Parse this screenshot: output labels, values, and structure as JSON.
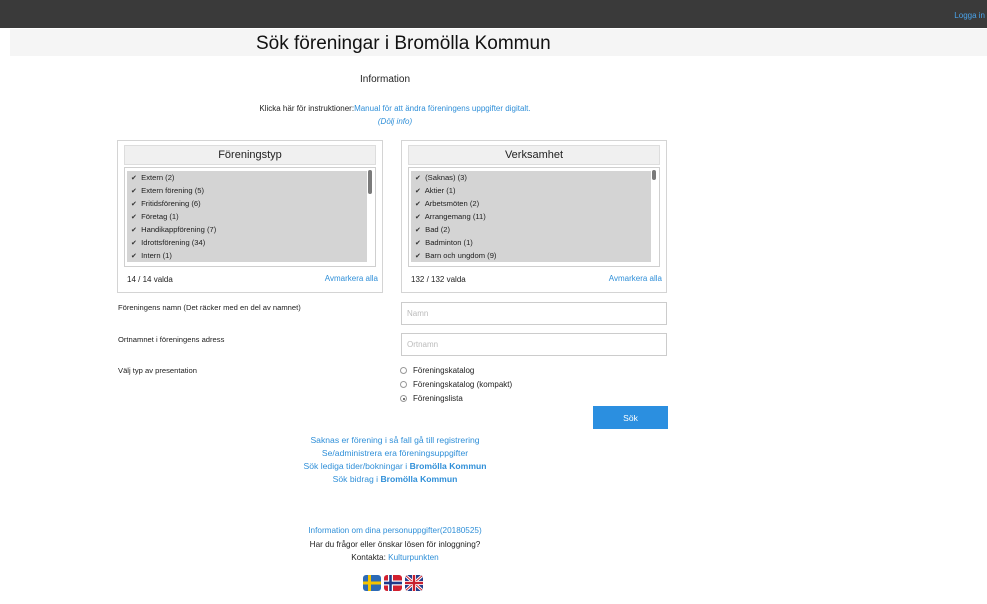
{
  "topbar": {
    "login_label": "Logga in"
  },
  "header": {
    "title": "Sök föreningar i Bromölla Kommun"
  },
  "info": {
    "title": "Information",
    "instructions_prefix": "Klicka här för instruktioner:",
    "manual_link": "Manual för att ändra föreningens uppgifter digitalt.",
    "hide_link": "(Dölj info)"
  },
  "foreningstyp": {
    "title": "Föreningstyp",
    "items": [
      "Extern (2)",
      "Extern förening (5)",
      "Fritidsförening (6)",
      "Företag (1)",
      "Handikappförening (7)",
      "Idrottsförening (34)",
      "Intern (1)"
    ],
    "count": "14 / 14 valda",
    "unmark_label": "Avmarkera alla"
  },
  "verksamhet": {
    "title": "Verksamhet",
    "items": [
      "(Saknas) (3)",
      "Aktier (1)",
      "Arbetsmöten (2)",
      "Arrangemang (11)",
      "Bad (2)",
      "Badminton (1)",
      "Barn och ungdom (9)"
    ],
    "count": "132 / 132 valda",
    "unmark_label": "Avmarkera alla"
  },
  "form": {
    "name_label": "Föreningens namn (Det räcker med en del av namnet)",
    "name_placeholder": "Namn",
    "city_label": "Ortnamnet i föreningens adress",
    "city_placeholder": "Ortnamn",
    "presentation_label": "Välj typ av presentation",
    "options": [
      "Föreningskatalog",
      "Föreningskatalog (kompakt)",
      "Föreningslista"
    ],
    "selected_option": "Föreningslista",
    "search_button": "Sök"
  },
  "links": {
    "register": "Saknas er förening i så fall gå till registrering",
    "admin": "Se/administrera era föreningsuppgifter",
    "booking_prefix": "Sök lediga tider/bokningar i ",
    "booking_place": "Bromölla Kommun",
    "grants_prefix": "Sök bidrag i ",
    "grants_place": "Bromölla Kommun"
  },
  "footer": {
    "privacy_link": "Information om dina personuppgifter(20180525)",
    "question": "Har du frågor eller önskar lösen för inloggning?",
    "contact_prefix": "Kontakta: ",
    "contact_link": "Kulturpunkten"
  },
  "flags": [
    "swedish-flag-icon",
    "norwegian-flag-icon",
    "uk-flag-icon"
  ],
  "colors": {
    "accent": "#2b8fe0",
    "link": "#2f8fd8",
    "topbar": "#3a3a3a"
  }
}
